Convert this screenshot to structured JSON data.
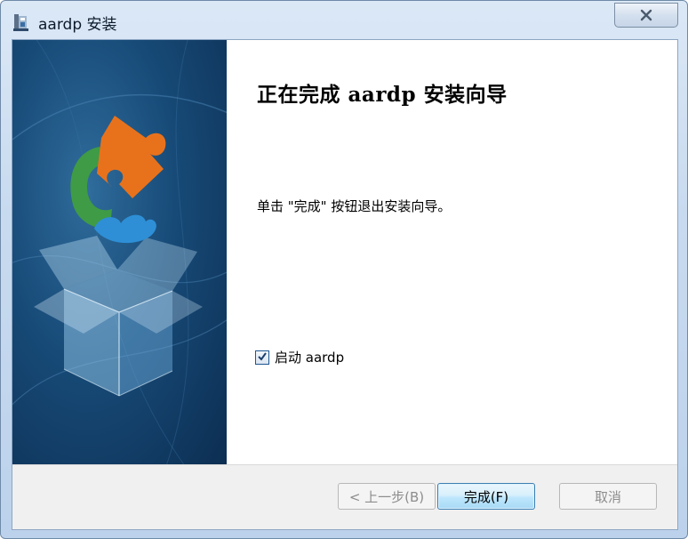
{
  "window": {
    "title": "aardp 安装",
    "icon": "installer-icon"
  },
  "titlebar": {
    "close_icon": "close-icon"
  },
  "side_panel": {
    "image": "puzzle-box-illustration"
  },
  "content": {
    "heading": "正在完成 aardp 安装向导",
    "instruction": "单击 \"完成\" 按钮退出安装向导。",
    "launch_checkbox": {
      "label": "启动 aardp",
      "checked": true
    }
  },
  "buttons": {
    "back_label": "< 上一步(B)",
    "finish_label": "完成(F)",
    "cancel_label": "取消"
  },
  "colors": {
    "panel_blue": "#174a77",
    "finish_border": "#3c7fb1",
    "puzzle_orange": "#e8721b",
    "puzzle_green": "#3f9b45",
    "puzzle_blue": "#2e8fd6"
  }
}
